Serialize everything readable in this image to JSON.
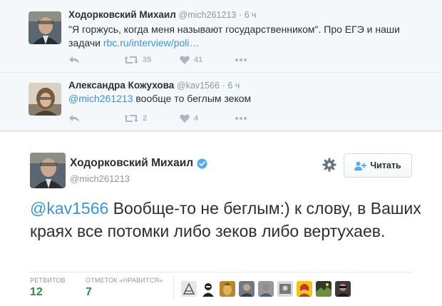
{
  "thread": [
    {
      "fullname": "Ходорковский Михаил",
      "handle": "@mich261213",
      "time": "· 6 ч",
      "text": "\"Я горжусь, когда меня называют государственником\". Про ЕГЭ и наши задачи",
      "link": "rbc.ru/interview/poli…",
      "retweets": "35",
      "likes": "41"
    },
    {
      "fullname": "Александра Кожухова",
      "handle": "@kav1566",
      "time": "· 6 ч",
      "mention": "@mich261213",
      "text": " вообще то беглым зеком",
      "retweets": "2",
      "likes": "4"
    }
  ],
  "main": {
    "fullname": "Ходорковский Михаил",
    "handle": "@mich261213",
    "follow_label": "Читать",
    "mention": "@kav1566",
    "text": " Вообще-то не беглым:) к слову, в Ваших краях все потомки либо зеков либо вертухаев.",
    "retweets_label": "РЕТВИТОВ",
    "retweets": "12",
    "likes_label": "ОТМЕТОК «НРАВИТСЯ»",
    "likes": "7"
  },
  "colors": {
    "link": "#3b94d9",
    "stat_value": "#2a8d49",
    "icon": "#aab8c2",
    "verified": "#55acee"
  },
  "icons": {
    "reply": "reply-icon",
    "retweet": "retweet-icon",
    "like": "heart-icon",
    "more": "more-icon",
    "verified": "verified-badge-icon",
    "gear": "gear-icon",
    "follow": "add-user-icon"
  }
}
